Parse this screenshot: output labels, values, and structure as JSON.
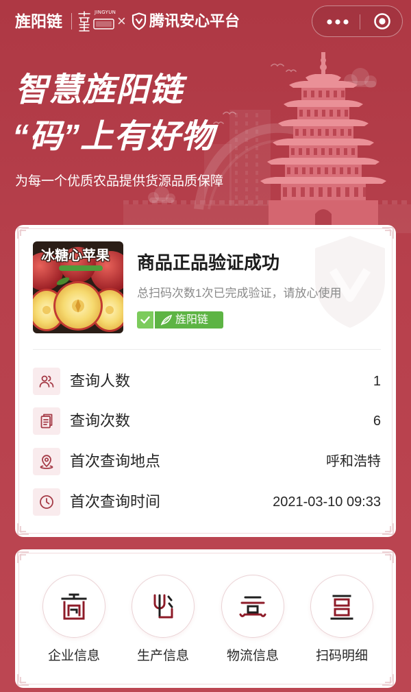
{
  "top_bar": {
    "brand": "旌阳链",
    "partner_logo_text": "JINGYUN",
    "separator": "×",
    "platform_icon": "shield-icon",
    "platform_name": "腾讯安心平台",
    "capsule": {
      "more_icon": "more-dots-icon",
      "close_icon": "target-circle-icon"
    }
  },
  "hero": {
    "title_line1": "智慧旌阳链",
    "title_line2": "“码”上有好物",
    "subtitle": "为每一个优质农品提供货源品质保障",
    "illustration_icon": "pagoda-skyline-illustration"
  },
  "verify_card": {
    "product_image": {
      "label": "冰糖心苹果",
      "icon": "apple-product-photo"
    },
    "title": "商品正品验证成功",
    "description": "总扫码次数1次已完成验证，请放心使用",
    "badge": {
      "check_icon": "check-icon",
      "leaf_icon": "leaf-logo-icon",
      "label": "旌阳链"
    },
    "stats": [
      {
        "icon": "people-icon",
        "label": "查询人数",
        "value": "1"
      },
      {
        "icon": "document-icon",
        "label": "查询次数",
        "value": "6"
      },
      {
        "icon": "location-pin-icon",
        "label": "首次查询地点",
        "value": "呼和浩特"
      },
      {
        "icon": "clock-icon",
        "label": "首次查询时间",
        "value": "2021-03-10 09:33"
      }
    ]
  },
  "menu_card": {
    "items": [
      {
        "icon": "enterprise-icon",
        "label": "企业信息"
      },
      {
        "icon": "production-icon",
        "label": "生产信息"
      },
      {
        "icon": "logistics-icon",
        "label": "物流信息"
      },
      {
        "icon": "scan-record-icon",
        "label": "扫码明细"
      }
    ]
  },
  "colors": {
    "page_background": "#b8414d",
    "card_background": "#ffffff",
    "accent_dark_red": "#8e1b28",
    "icon_red": "#a53a46",
    "badge_green": "#5db444",
    "badge_check_green": "#7ccb5c",
    "text_primary": "#262626",
    "text_secondary": "#8a8a8a"
  }
}
